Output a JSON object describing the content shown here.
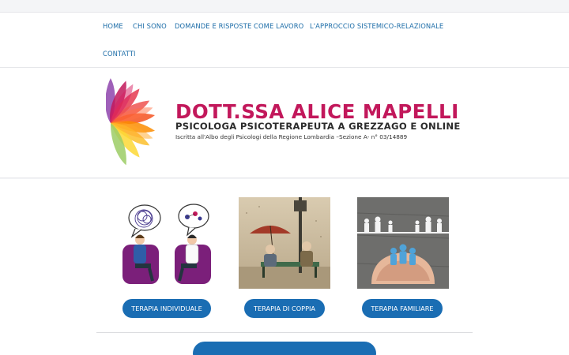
{
  "nav": {
    "items": [
      "HOME",
      "CHI SONO",
      "DOMANDE E RISPOSTE",
      "COME LAVORO",
      "L'APPROCCIO SISTEMICO-RELAZIONALE",
      "CONTATTI"
    ]
  },
  "header": {
    "name": "DOTT.SSA ALICE MAPELLI",
    "subtitle": "PSICOLOGA PSICOTERAPEUTA A GREZZAGO E ONLINE",
    "albo": "Iscritta all'Albo degli Psicologi della Regione Lombardia –Sezione A- n° 03/14889"
  },
  "cards": [
    {
      "button": "TERAPIA INDIVIDUALE"
    },
    {
      "button": "TERAPIA DI COPPIA"
    },
    {
      "button": "TERAPIA FAMILIARE"
    }
  ],
  "colors": {
    "accent": "#1a6db3",
    "brand": "#c2185b",
    "nav_link": "#1d6da8"
  }
}
